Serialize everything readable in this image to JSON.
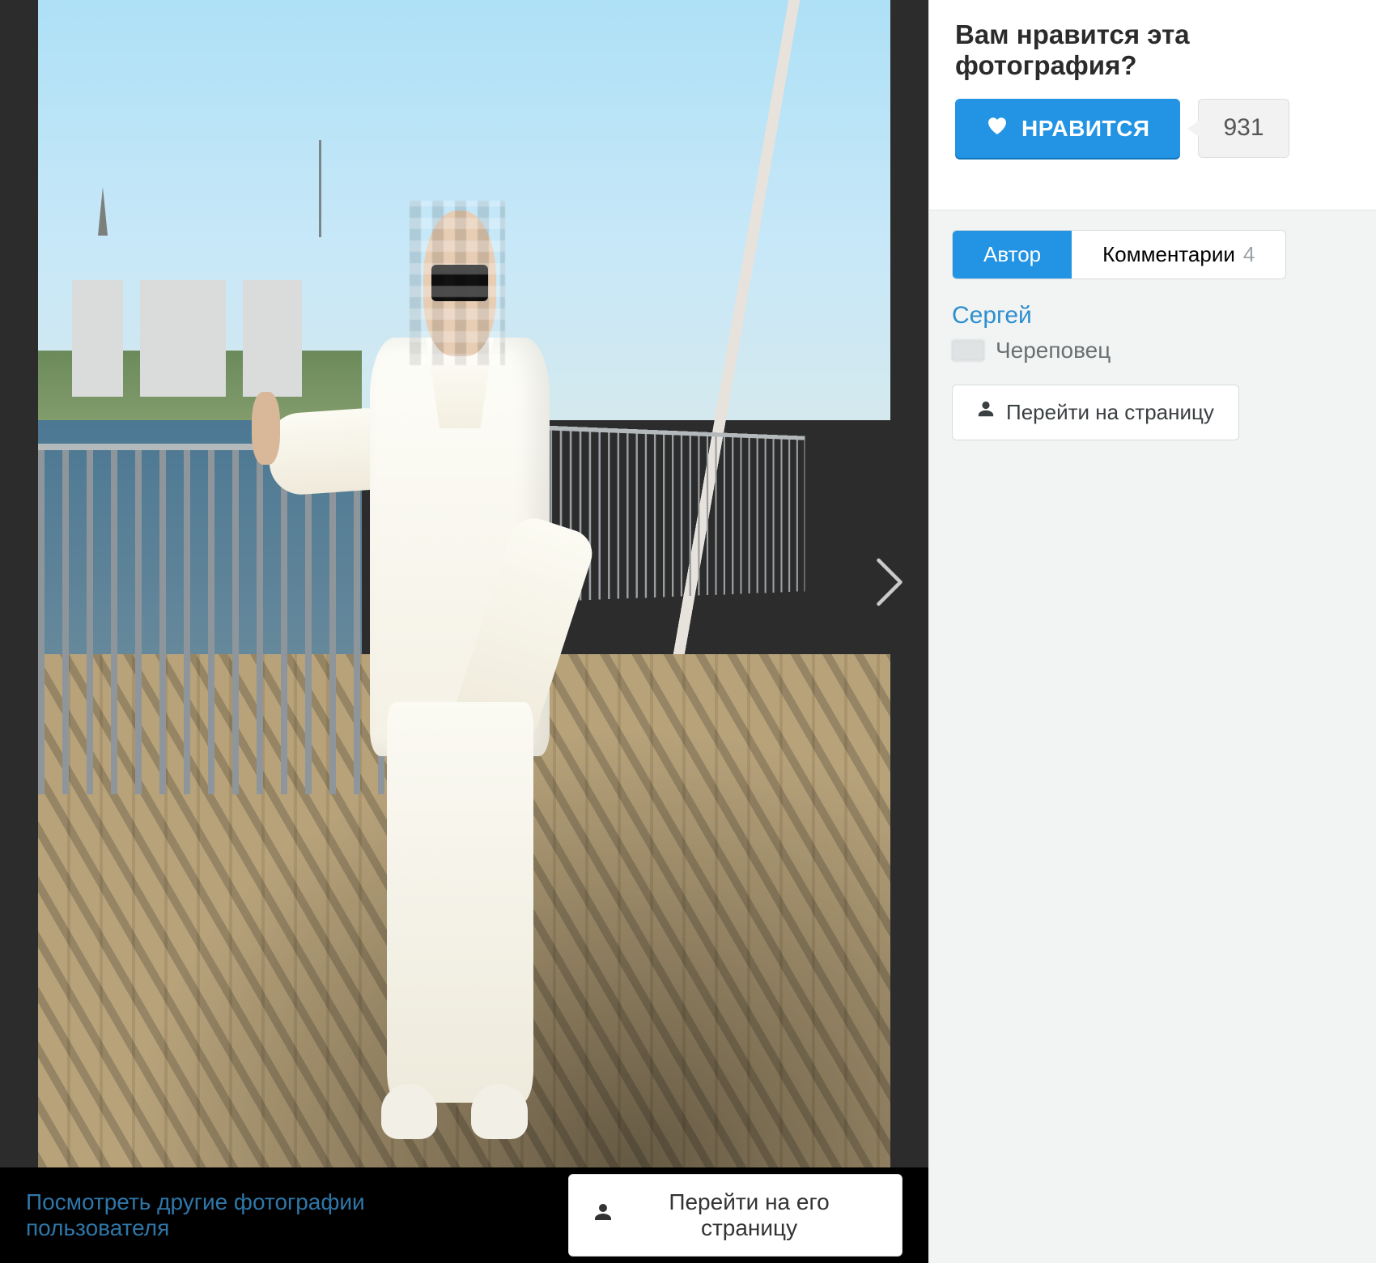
{
  "like": {
    "question": "Вам нравится эта фотография?",
    "button_label": "НРАВИТСЯ",
    "count": "931"
  },
  "tabs": {
    "author_label": "Автор",
    "comments_label": "Комментарии",
    "comments_count": "4"
  },
  "author": {
    "name": "Сергей",
    "city": "Череповец",
    "goto_label": "Перейти на страницу"
  },
  "footer": {
    "more_photos_link": "Посмотреть другие фотографии пользователя",
    "goto_profile_label": "Перейти на его страницу"
  }
}
